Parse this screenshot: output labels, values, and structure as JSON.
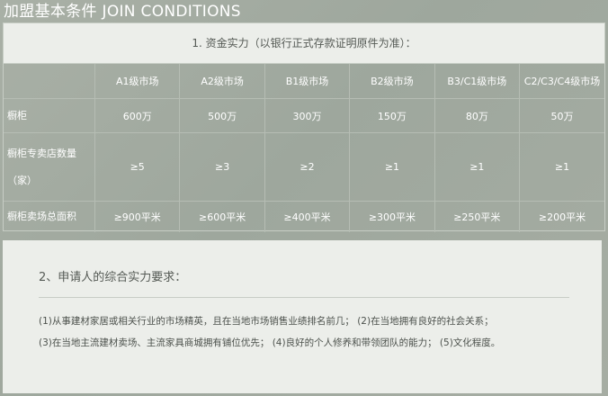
{
  "title": "加盟基本条件  JOIN CONDITIONS",
  "funds": {
    "heading": "1. 资金实力（以银行正式存款证明原件为准）：",
    "columns": [
      "A1级市场",
      "A2级市场",
      "B1级市场",
      "B2级市场",
      "B3/C1级市场",
      "C2/C3/C4级市场"
    ],
    "rows": [
      {
        "label": "橱柜",
        "values": [
          "600万",
          "500万",
          "300万",
          "150万",
          "80万",
          "50万"
        ]
      },
      {
        "label_line1": "橱柜专卖店数量",
        "label_line2": "（家）",
        "values": [
          "≥5",
          "≥3",
          "≥2",
          "≥1",
          "≥1",
          "≥1"
        ]
      },
      {
        "label": "橱柜卖场总面积",
        "values": [
          "≥900平米",
          "≥600平米",
          "≥400平米",
          "≥300平米",
          "≥250平米",
          "≥200平米"
        ]
      }
    ]
  },
  "applicant": {
    "heading": "2、申请人的综合实力要求：",
    "line1": "(1)从事建材家居或相关行业的市场精英，且在当地市场销售业绩排名前几； (2)在当地拥有良好的社会关系；",
    "line2": "(3)在当地主流建材卖场、主流家具商城拥有铺位优先； (4)良好的个人修养和带领团队的能力； (5)文化程度。"
  }
}
